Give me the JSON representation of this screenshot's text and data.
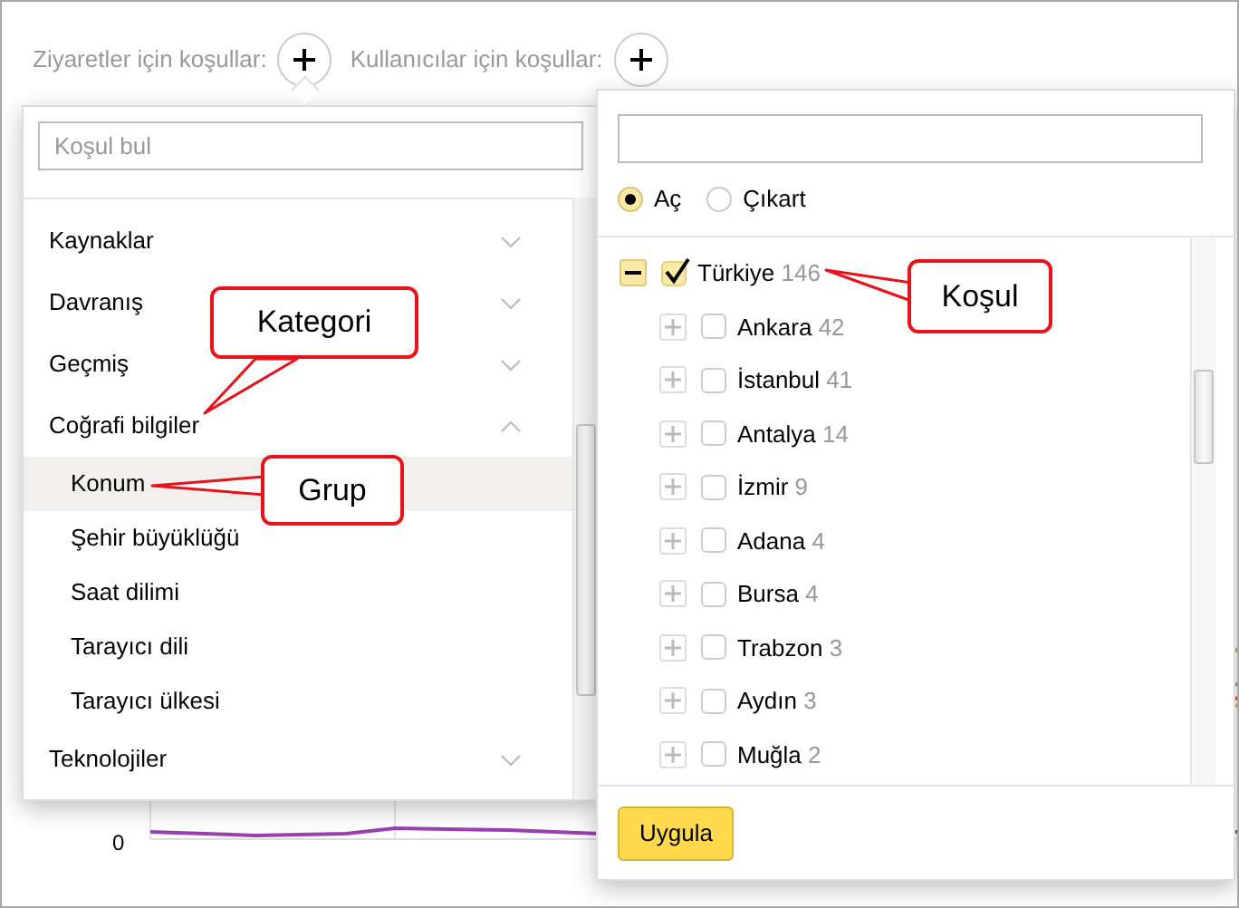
{
  "condition_bar": [
    {
      "label": "Ziyaretler için koşullar:",
      "selected": true
    },
    {
      "label": "Kullanıcılar için koşullar:",
      "selected": false
    }
  ],
  "category_panel": {
    "search": {
      "placeholder": "Koşul bul"
    },
    "categories": [
      {
        "label": "Kaynaklar",
        "expanded": false
      },
      {
        "label": "Davranış",
        "expanded": false
      },
      {
        "label": "Geçmiş",
        "expanded": false
      },
      {
        "label": "Coğrafi bilgiler",
        "expanded": true,
        "children": [
          {
            "label": "Konum",
            "selected": true
          },
          {
            "label": "Şehir büyüklüğü",
            "selected": false
          },
          {
            "label": "Saat dilimi",
            "selected": false
          },
          {
            "label": "Tarayıcı dili",
            "selected": false
          },
          {
            "label": "Tarayıcı ülkesi",
            "selected": false
          }
        ]
      },
      {
        "label": "Teknolojiler",
        "expanded": false
      }
    ]
  },
  "condition_panel": {
    "mode": [
      {
        "label": "Aç",
        "selected": true
      },
      {
        "label": "Çıkart",
        "selected": false
      }
    ],
    "tree": [
      {
        "label": "Türkiye",
        "count": "146",
        "checked": true,
        "expanded": true,
        "children": [
          {
            "label": "Ankara",
            "count": "42",
            "checked": false,
            "expanded": false
          },
          {
            "label": "İstanbul",
            "count": "41",
            "checked": false,
            "expanded": false
          },
          {
            "label": "Antalya",
            "count": "14",
            "checked": false,
            "expanded": false
          },
          {
            "label": "İzmir",
            "count": "9",
            "checked": false,
            "expanded": false
          },
          {
            "label": "Adana",
            "count": "4",
            "checked": false,
            "expanded": false
          },
          {
            "label": "Bursa",
            "count": "4",
            "checked": false,
            "expanded": false
          },
          {
            "label": "Trabzon",
            "count": "3",
            "checked": false,
            "expanded": false
          },
          {
            "label": "Aydın",
            "count": "3",
            "checked": false,
            "expanded": false
          },
          {
            "label": "Muğla",
            "count": "2",
            "checked": false,
            "expanded": false
          }
        ]
      }
    ],
    "apply_button": "Uygula"
  },
  "chart": {
    "y_tick": "0"
  },
  "callouts": [
    {
      "text": "Kategori"
    },
    {
      "text": "Grup"
    },
    {
      "text": "Koşul"
    }
  ]
}
